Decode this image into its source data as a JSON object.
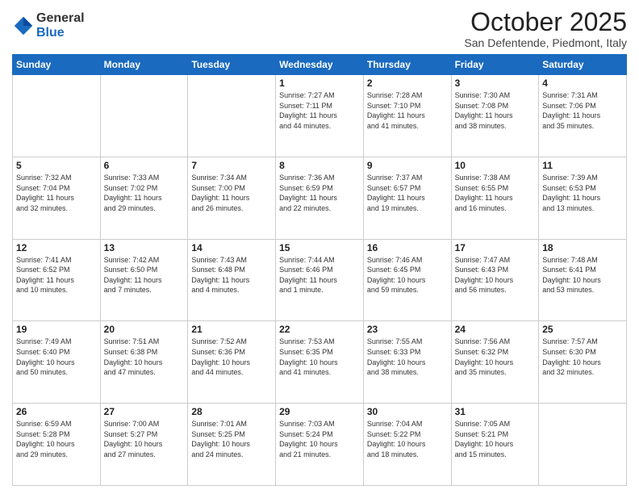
{
  "logo": {
    "general": "General",
    "blue": "Blue"
  },
  "header": {
    "month": "October 2025",
    "location": "San Defentende, Piedmont, Italy"
  },
  "days_of_week": [
    "Sunday",
    "Monday",
    "Tuesday",
    "Wednesday",
    "Thursday",
    "Friday",
    "Saturday"
  ],
  "weeks": [
    [
      {
        "day": "",
        "info": ""
      },
      {
        "day": "",
        "info": ""
      },
      {
        "day": "",
        "info": ""
      },
      {
        "day": "1",
        "info": "Sunrise: 7:27 AM\nSunset: 7:11 PM\nDaylight: 11 hours\nand 44 minutes."
      },
      {
        "day": "2",
        "info": "Sunrise: 7:28 AM\nSunset: 7:10 PM\nDaylight: 11 hours\nand 41 minutes."
      },
      {
        "day": "3",
        "info": "Sunrise: 7:30 AM\nSunset: 7:08 PM\nDaylight: 11 hours\nand 38 minutes."
      },
      {
        "day": "4",
        "info": "Sunrise: 7:31 AM\nSunset: 7:06 PM\nDaylight: 11 hours\nand 35 minutes."
      }
    ],
    [
      {
        "day": "5",
        "info": "Sunrise: 7:32 AM\nSunset: 7:04 PM\nDaylight: 11 hours\nand 32 minutes."
      },
      {
        "day": "6",
        "info": "Sunrise: 7:33 AM\nSunset: 7:02 PM\nDaylight: 11 hours\nand 29 minutes."
      },
      {
        "day": "7",
        "info": "Sunrise: 7:34 AM\nSunset: 7:00 PM\nDaylight: 11 hours\nand 26 minutes."
      },
      {
        "day": "8",
        "info": "Sunrise: 7:36 AM\nSunset: 6:59 PM\nDaylight: 11 hours\nand 22 minutes."
      },
      {
        "day": "9",
        "info": "Sunrise: 7:37 AM\nSunset: 6:57 PM\nDaylight: 11 hours\nand 19 minutes."
      },
      {
        "day": "10",
        "info": "Sunrise: 7:38 AM\nSunset: 6:55 PM\nDaylight: 11 hours\nand 16 minutes."
      },
      {
        "day": "11",
        "info": "Sunrise: 7:39 AM\nSunset: 6:53 PM\nDaylight: 11 hours\nand 13 minutes."
      }
    ],
    [
      {
        "day": "12",
        "info": "Sunrise: 7:41 AM\nSunset: 6:52 PM\nDaylight: 11 hours\nand 10 minutes."
      },
      {
        "day": "13",
        "info": "Sunrise: 7:42 AM\nSunset: 6:50 PM\nDaylight: 11 hours\nand 7 minutes."
      },
      {
        "day": "14",
        "info": "Sunrise: 7:43 AM\nSunset: 6:48 PM\nDaylight: 11 hours\nand 4 minutes."
      },
      {
        "day": "15",
        "info": "Sunrise: 7:44 AM\nSunset: 6:46 PM\nDaylight: 11 hours\nand 1 minute."
      },
      {
        "day": "16",
        "info": "Sunrise: 7:46 AM\nSunset: 6:45 PM\nDaylight: 10 hours\nand 59 minutes."
      },
      {
        "day": "17",
        "info": "Sunrise: 7:47 AM\nSunset: 6:43 PM\nDaylight: 10 hours\nand 56 minutes."
      },
      {
        "day": "18",
        "info": "Sunrise: 7:48 AM\nSunset: 6:41 PM\nDaylight: 10 hours\nand 53 minutes."
      }
    ],
    [
      {
        "day": "19",
        "info": "Sunrise: 7:49 AM\nSunset: 6:40 PM\nDaylight: 10 hours\nand 50 minutes."
      },
      {
        "day": "20",
        "info": "Sunrise: 7:51 AM\nSunset: 6:38 PM\nDaylight: 10 hours\nand 47 minutes."
      },
      {
        "day": "21",
        "info": "Sunrise: 7:52 AM\nSunset: 6:36 PM\nDaylight: 10 hours\nand 44 minutes."
      },
      {
        "day": "22",
        "info": "Sunrise: 7:53 AM\nSunset: 6:35 PM\nDaylight: 10 hours\nand 41 minutes."
      },
      {
        "day": "23",
        "info": "Sunrise: 7:55 AM\nSunset: 6:33 PM\nDaylight: 10 hours\nand 38 minutes."
      },
      {
        "day": "24",
        "info": "Sunrise: 7:56 AM\nSunset: 6:32 PM\nDaylight: 10 hours\nand 35 minutes."
      },
      {
        "day": "25",
        "info": "Sunrise: 7:57 AM\nSunset: 6:30 PM\nDaylight: 10 hours\nand 32 minutes."
      }
    ],
    [
      {
        "day": "26",
        "info": "Sunrise: 6:59 AM\nSunset: 5:28 PM\nDaylight: 10 hours\nand 29 minutes."
      },
      {
        "day": "27",
        "info": "Sunrise: 7:00 AM\nSunset: 5:27 PM\nDaylight: 10 hours\nand 27 minutes."
      },
      {
        "day": "28",
        "info": "Sunrise: 7:01 AM\nSunset: 5:25 PM\nDaylight: 10 hours\nand 24 minutes."
      },
      {
        "day": "29",
        "info": "Sunrise: 7:03 AM\nSunset: 5:24 PM\nDaylight: 10 hours\nand 21 minutes."
      },
      {
        "day": "30",
        "info": "Sunrise: 7:04 AM\nSunset: 5:22 PM\nDaylight: 10 hours\nand 18 minutes."
      },
      {
        "day": "31",
        "info": "Sunrise: 7:05 AM\nSunset: 5:21 PM\nDaylight: 10 hours\nand 15 minutes."
      },
      {
        "day": "",
        "info": ""
      }
    ]
  ]
}
